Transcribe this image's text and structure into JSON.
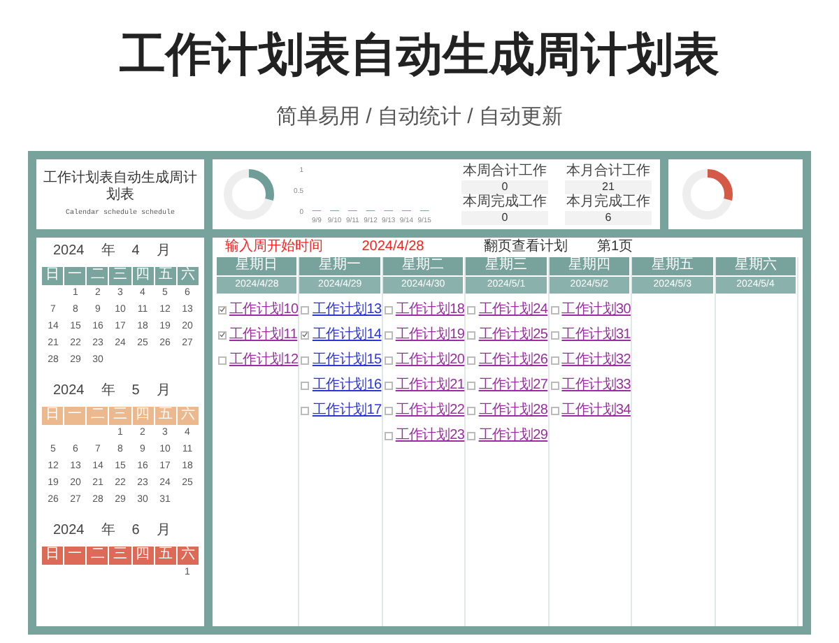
{
  "header": {
    "title": "工作计划表自动生成周计划表",
    "subtitle": "简单易用 / 自动统计 / 自动更新"
  },
  "summary": {
    "title": "工作计划表自动生成周计划表",
    "subtitle": "Calendar schedule schedule",
    "week_donut": {
      "level": 0.29
    },
    "chart_data": {
      "type": "bar",
      "categories": [
        "9/9",
        "9/10",
        "9/11",
        "9/12",
        "9/13",
        "9/14",
        "9/15"
      ],
      "values": [
        0,
        0,
        0,
        0,
        0,
        0,
        0
      ],
      "ylim": [
        0,
        1
      ],
      "yticks": [
        0,
        0.5,
        1
      ]
    },
    "stats": [
      {
        "label": "本周合计工作",
        "value": "0"
      },
      {
        "label": "本月合计工作",
        "value": "21"
      },
      {
        "label": "本周完成工作",
        "value": "0"
      },
      {
        "label": "本月完成工作",
        "value": "6"
      }
    ],
    "month_donut": {
      "level": 0.29
    }
  },
  "calendars": [
    {
      "year": "2024",
      "year_unit": "年",
      "month": "4",
      "month_unit": "月",
      "color": "#79a59e",
      "weekdays": [
        "日",
        "一",
        "二",
        "三",
        "四",
        "五",
        "六"
      ],
      "weeks": [
        {
          "kind": "start",
          "days": [
            "1",
            "2",
            "3",
            "4",
            "5",
            "6"
          ]
        },
        {
          "kind": "full",
          "days": [
            "7",
            "8",
            "9",
            "10",
            "11",
            "12",
            "13"
          ]
        },
        {
          "kind": "full",
          "days": [
            "14",
            "15",
            "16",
            "17",
            "18",
            "19",
            "20"
          ]
        },
        {
          "kind": "full",
          "days": [
            "21",
            "22",
            "23",
            "24",
            "25",
            "26",
            "27"
          ]
        },
        {
          "kind": "end",
          "days": [
            "28",
            "29",
            "30"
          ]
        }
      ]
    },
    {
      "year": "2024",
      "year_unit": "年",
      "month": "5",
      "month_unit": "月",
      "color": "#ecb98f",
      "weekdays": [
        "日",
        "一",
        "二",
        "三",
        "四",
        "五",
        "六"
      ],
      "weeks": [
        {
          "kind": "start",
          "days": [
            "1",
            "2",
            "3",
            "4"
          ]
        },
        {
          "kind": "full",
          "days": [
            "5",
            "6",
            "7",
            "8",
            "9",
            "10",
            "11"
          ]
        },
        {
          "kind": "full",
          "days": [
            "12",
            "13",
            "14",
            "15",
            "16",
            "17",
            "18"
          ]
        },
        {
          "kind": "full",
          "days": [
            "19",
            "20",
            "21",
            "22",
            "23",
            "24",
            "25"
          ]
        },
        {
          "kind": "end",
          "days": [
            "26",
            "27",
            "28",
            "29",
            "30",
            "31"
          ]
        }
      ]
    },
    {
      "year": "2024",
      "year_unit": "年",
      "month": "6",
      "month_unit": "月",
      "color": "#dc6a56",
      "weekdays": [
        "日",
        "一",
        "二",
        "三",
        "四",
        "五",
        "六"
      ],
      "weeks": [
        {
          "kind": "start",
          "days": [
            "1"
          ]
        }
      ]
    }
  ],
  "planner": {
    "start_label": "输入周开始时间",
    "start_date": "2024/4/28",
    "page_label": "翻页查看计划",
    "page": "第1页",
    "days": [
      {
        "weekday": "星期日",
        "date": "2024/4/28",
        "tasks": [
          {
            "title": "工作计划10",
            "checked": true,
            "visited": true
          },
          {
            "title": "工作计划11",
            "checked": true,
            "visited": true
          },
          {
            "title": "工作计划12",
            "checked": false,
            "visited": true
          }
        ]
      },
      {
        "weekday": "星期一",
        "date": "2024/4/29",
        "tasks": [
          {
            "title": "工作计划13",
            "checked": false,
            "visited": false
          },
          {
            "title": "工作计划14",
            "checked": true,
            "visited": false
          },
          {
            "title": "工作计划15",
            "checked": false,
            "visited": false
          },
          {
            "title": "工作计划16",
            "checked": false,
            "visited": false
          },
          {
            "title": "工作计划17",
            "checked": false,
            "visited": false
          }
        ]
      },
      {
        "weekday": "星期二",
        "date": "2024/4/30",
        "tasks": [
          {
            "title": "工作计划18",
            "checked": false,
            "visited": true
          },
          {
            "title": "工作计划19",
            "checked": false,
            "visited": true
          },
          {
            "title": "工作计划20",
            "checked": false,
            "visited": true
          },
          {
            "title": "工作计划21",
            "checked": false,
            "visited": true
          },
          {
            "title": "工作计划22",
            "checked": false,
            "visited": true
          },
          {
            "title": "工作计划23",
            "checked": false,
            "visited": true
          }
        ]
      },
      {
        "weekday": "星期三",
        "date": "2024/5/1",
        "tasks": [
          {
            "title": "工作计划24",
            "checked": false,
            "visited": true
          },
          {
            "title": "工作计划25",
            "checked": false,
            "visited": true
          },
          {
            "title": "工作计划26",
            "checked": false,
            "visited": true
          },
          {
            "title": "工作计划27",
            "checked": false,
            "visited": true
          },
          {
            "title": "工作计划28",
            "checked": false,
            "visited": true
          },
          {
            "title": "工作计划29",
            "checked": false,
            "visited": true
          }
        ]
      },
      {
        "weekday": "星期四",
        "date": "2024/5/2",
        "tasks": [
          {
            "title": "工作计划30",
            "checked": false,
            "visited": true
          },
          {
            "title": "工作计划31",
            "checked": false,
            "visited": true
          },
          {
            "title": "工作计划32",
            "checked": false,
            "visited": true
          },
          {
            "title": "工作计划33",
            "checked": false,
            "visited": true
          },
          {
            "title": "工作计划34",
            "checked": false,
            "visited": true
          }
        ]
      },
      {
        "weekday": "星期五",
        "date": "2024/5/3"
      },
      {
        "weekday": "星期六",
        "date": "2024/5/4"
      }
    ]
  }
}
